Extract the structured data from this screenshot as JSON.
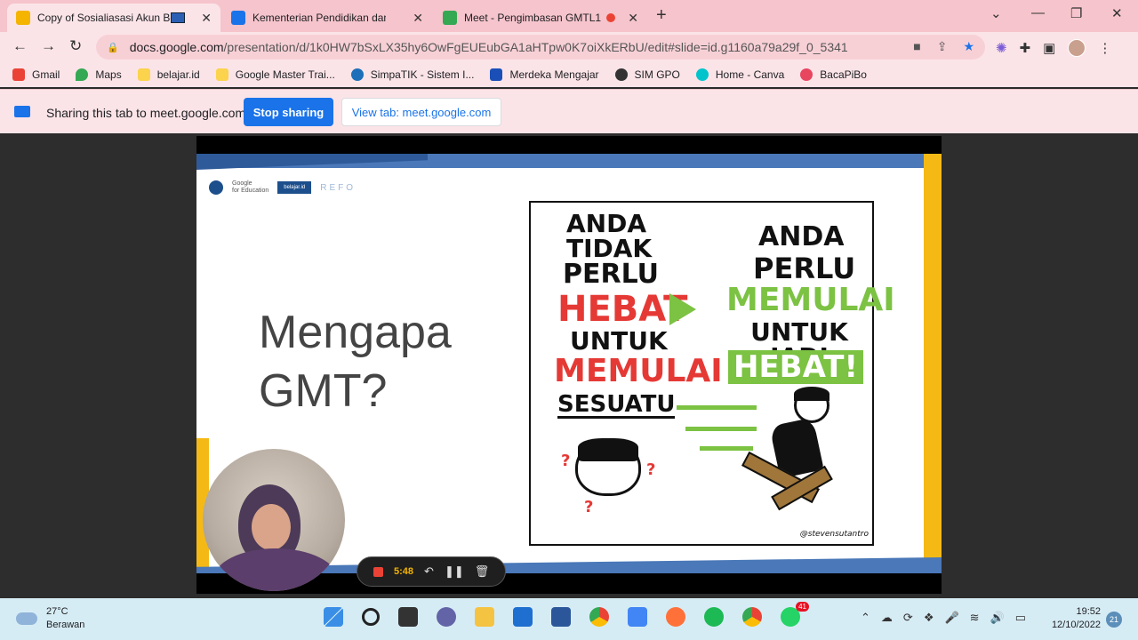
{
  "browser": {
    "tabs": [
      {
        "title": "Copy of Sosialiasasi Akun Be",
        "color": "#f4b400"
      },
      {
        "title": "Kementerian Pendidikan dan Keb",
        "color": "#1a73e8"
      },
      {
        "title": "Meet - Pengimbasan GMTL1",
        "color": "#34a853"
      }
    ],
    "url_host": "docs.google.com",
    "url_path": "/presentation/d/1k0HW7bSxLX35hy6OwFgEUEubGA1aHTpw0K7oiXkERbU/edit#slide=id.g1160a79a29f_0_5341",
    "bookmarks": [
      {
        "label": "Gmail",
        "color": "#ea4335"
      },
      {
        "label": "Maps",
        "color": "#34a853"
      },
      {
        "label": "belajar.id",
        "color": "#fbd34d"
      },
      {
        "label": "Google Master Trai...",
        "color": "#fbd34d"
      },
      {
        "label": "SimpaTIK - Sistem I...",
        "color": "#1c6fb8"
      },
      {
        "label": "Merdeka Mengajar",
        "color": "#1a4fb8"
      },
      {
        "label": "SIM GPO",
        "color": "#333333"
      },
      {
        "label": "Home - Canva",
        "color": "#00c4cc"
      },
      {
        "label": "BacaPiBo",
        "color": "#e8455f"
      }
    ]
  },
  "sharing": {
    "text": "Sharing this tab to meet.google.com",
    "stop_label": "Stop sharing",
    "view_label": "View tab: meet.google.com"
  },
  "slide": {
    "logo_google_line1": "Google",
    "logo_google_line2": "for Education",
    "logo_belajar": "belajar.id",
    "logo_refo": "REFO",
    "title_line1": "Mengapa",
    "title_line2": "GMT?",
    "comic": {
      "left_1": "ANDA",
      "left_2": "TIDAK",
      "left_3": "PERLU",
      "left_4": "HEBAT",
      "left_5": "UNTUK",
      "left_6": "MEMULAI",
      "left_7": "SESUATU",
      "right_1": "ANDA",
      "right_2": "PERLU",
      "right_3": "MEMULAI",
      "right_4": "UNTUK JADI",
      "right_5": "HEBAT!",
      "credit": "@stevensutantro"
    }
  },
  "recording": {
    "time": "5:48"
  },
  "taskbar": {
    "temp": "27°C",
    "weather": "Berawan",
    "time": "19:52",
    "date": "12/10/2022",
    "notif_count": "21",
    "whatsapp_badge": "41"
  }
}
